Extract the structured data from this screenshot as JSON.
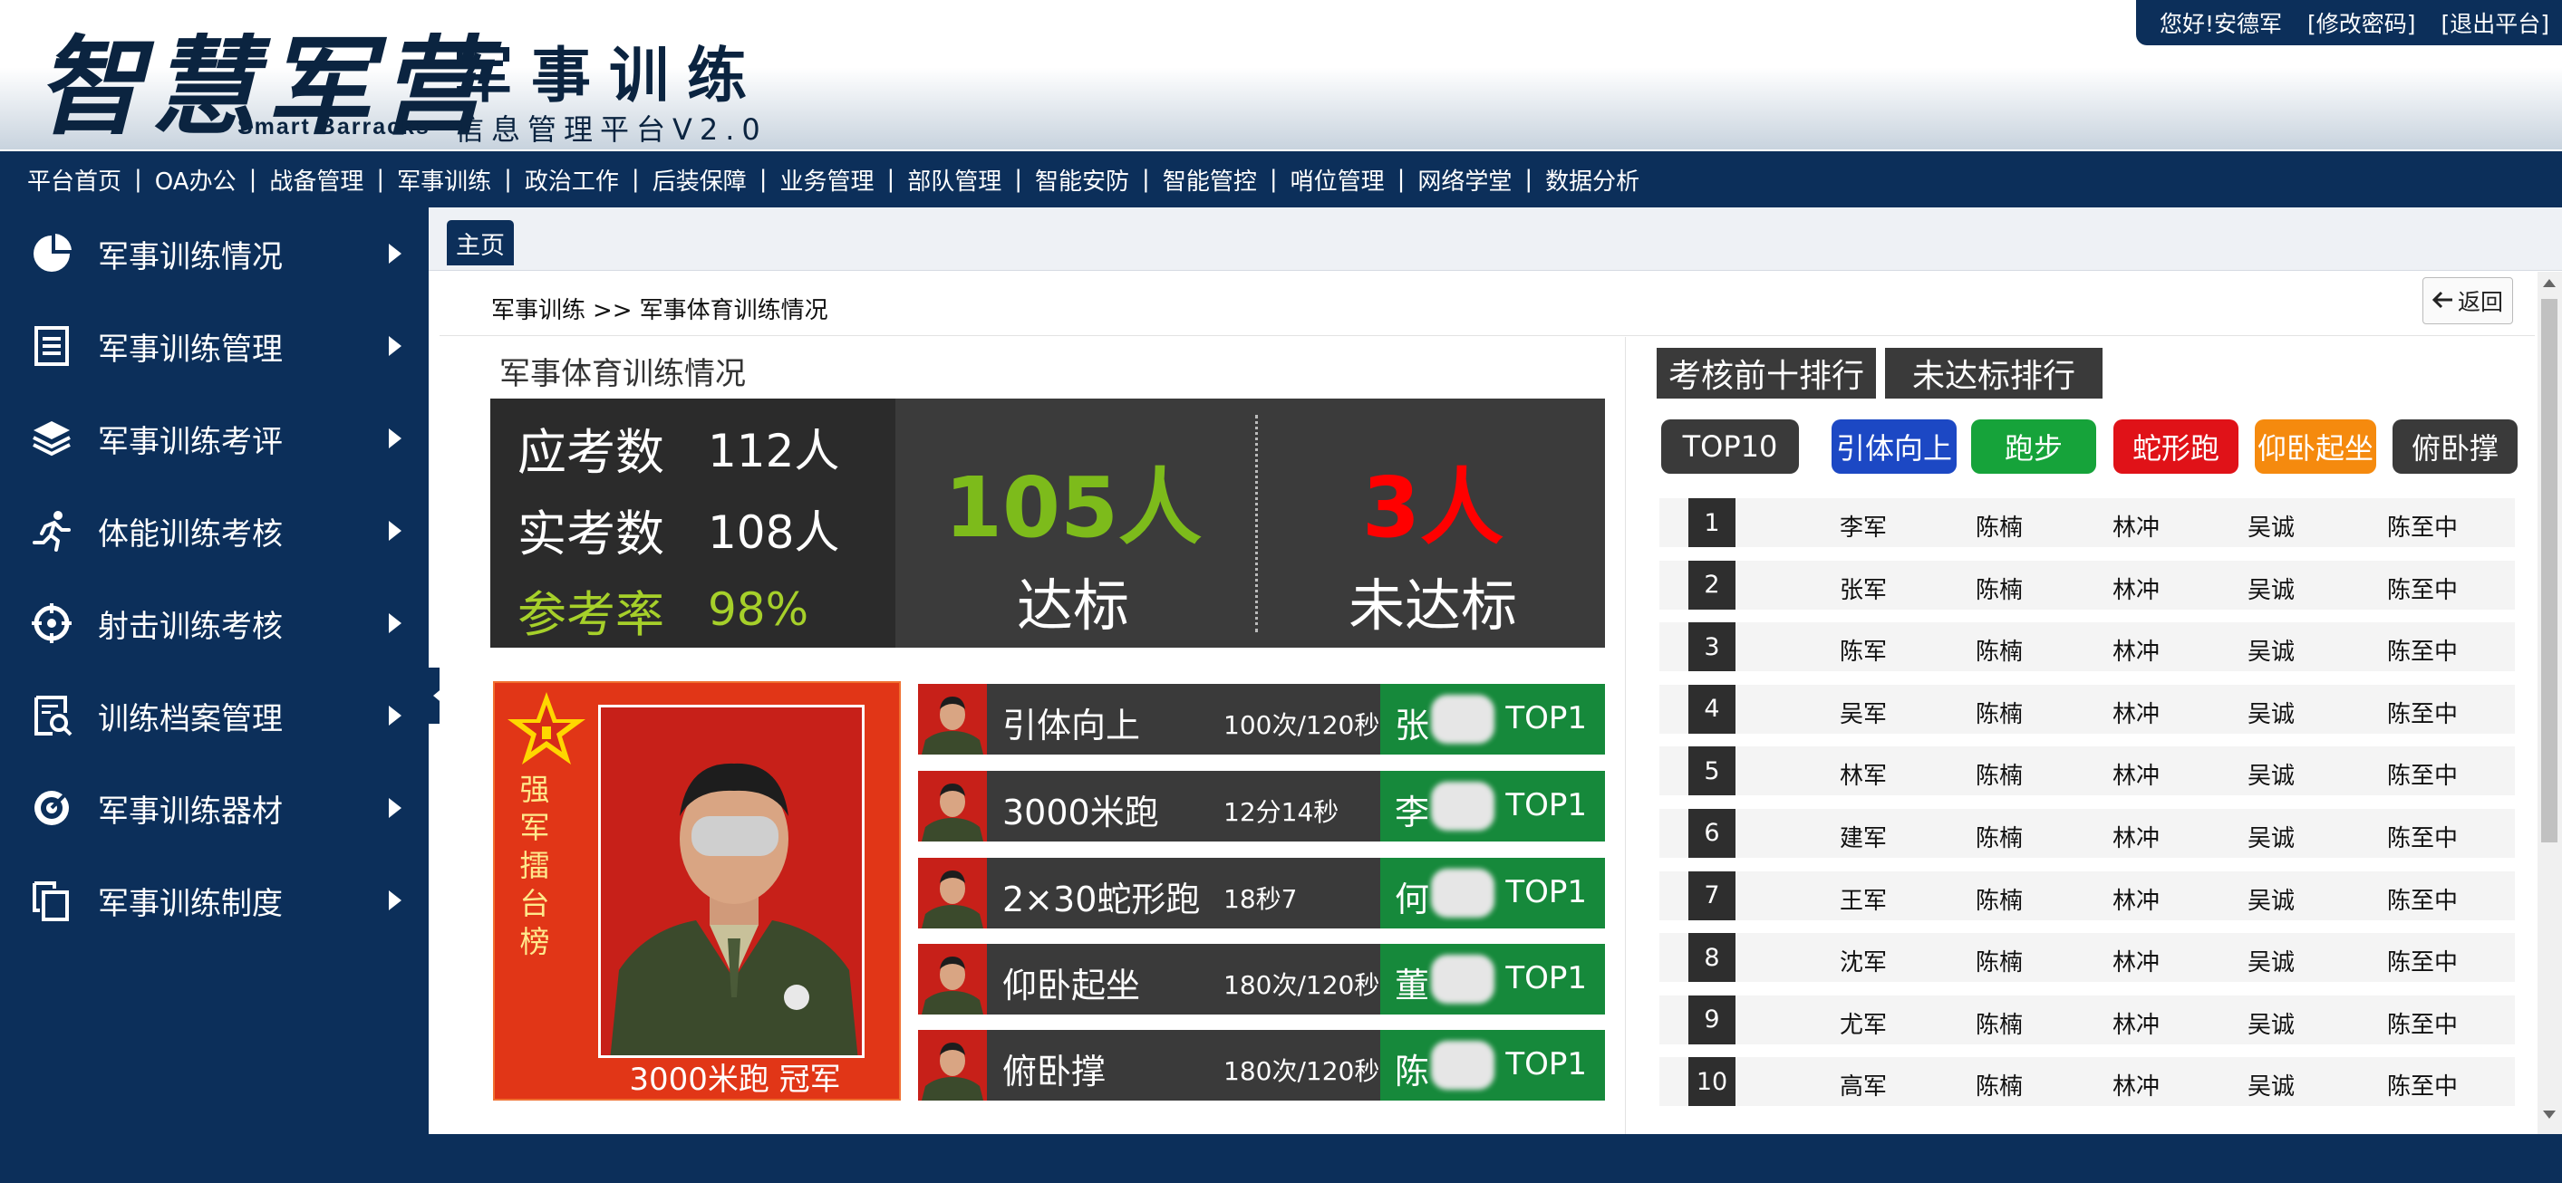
{
  "header": {
    "logo_script": "智慧军营",
    "logo_en": "Smart  Barracks",
    "title": "军事训练",
    "subtitle": "信息管理平台V2.0",
    "greeting": "您好!安德军",
    "change_password": "[修改密码]",
    "logout": "[退出平台]"
  },
  "topnav": [
    "平台首页",
    "OA办公",
    "战备管理",
    "军事训练",
    "政治工作",
    "后装保障",
    "业务管理",
    "部队管理",
    "智能安防",
    "智能管控",
    "哨位管理",
    "网络学堂",
    "数据分析"
  ],
  "sidebar": {
    "items": [
      {
        "label": "军事训练情况",
        "icon": "pie-chart-icon"
      },
      {
        "label": "军事训练管理",
        "icon": "document-list-icon"
      },
      {
        "label": "军事训练考评",
        "icon": "layers-icon"
      },
      {
        "label": "体能训练考核",
        "icon": "running-person-icon"
      },
      {
        "label": "射击训练考核",
        "icon": "crosshair-icon"
      },
      {
        "label": "训练档案管理",
        "icon": "document-search-icon"
      },
      {
        "label": "军事训练器材",
        "icon": "target-icon"
      },
      {
        "label": "军事训练制度",
        "icon": "copy-documents-icon"
      }
    ]
  },
  "tabs": {
    "home": "主页"
  },
  "breadcrumb": {
    "parent": "军事训练",
    "sep": ">>",
    "current": "军事体育训练情况"
  },
  "back_label": "返回",
  "section_title": "军事体育训练情况",
  "stats": {
    "expected_label": "应考数",
    "expected_value": "112人",
    "actual_label": "实考数",
    "actual_value": "108人",
    "rate_label": "参考率",
    "rate_value": "98%",
    "pass_count": "105人",
    "pass_label": "达标",
    "fail_count": "3人",
    "fail_label": "未达标"
  },
  "champion": {
    "vertical_text": "强军擂台榜",
    "caption": "3000米跑 冠军"
  },
  "top_events": [
    {
      "event": "引体向上",
      "score": "100次/120秒",
      "name": "张",
      "rank": "TOP1"
    },
    {
      "event": "3000米跑",
      "score": "12分14秒",
      "name": "李",
      "rank": "TOP1"
    },
    {
      "event": "2×30蛇形跑",
      "score": "18秒7",
      "name": "何",
      "rank": "TOP1"
    },
    {
      "event": "仰卧起坐",
      "score": "180次/120秒",
      "name": "董",
      "rank": "TOP1"
    },
    {
      "event": "俯卧撑",
      "score": "180次/120秒",
      "name": "陈",
      "rank": "TOP1"
    }
  ],
  "ranking": {
    "tab_top10": "考核前十排行",
    "tab_fail": "未达标排行",
    "filters": {
      "top10": "TOP10",
      "pullup": "引体向上",
      "run": "跑步",
      "snake": "蛇形跑",
      "situp": "仰卧起坐",
      "pushup": "俯卧撑"
    },
    "rows": [
      {
        "no": "1",
        "c1": "李军",
        "c2": "陈楠",
        "c3": "林冲",
        "c4": "吴诚",
        "c5": "陈至中"
      },
      {
        "no": "2",
        "c1": "张军",
        "c2": "陈楠",
        "c3": "林冲",
        "c4": "吴诚",
        "c5": "陈至中"
      },
      {
        "no": "3",
        "c1": "陈军",
        "c2": "陈楠",
        "c3": "林冲",
        "c4": "吴诚",
        "c5": "陈至中"
      },
      {
        "no": "4",
        "c1": "吴军",
        "c2": "陈楠",
        "c3": "林冲",
        "c4": "吴诚",
        "c5": "陈至中"
      },
      {
        "no": "5",
        "c1": "林军",
        "c2": "陈楠",
        "c3": "林冲",
        "c4": "吴诚",
        "c5": "陈至中"
      },
      {
        "no": "6",
        "c1": "建军",
        "c2": "陈楠",
        "c3": "林冲",
        "c4": "吴诚",
        "c5": "陈至中"
      },
      {
        "no": "7",
        "c1": "王军",
        "c2": "陈楠",
        "c3": "林冲",
        "c4": "吴诚",
        "c5": "陈至中"
      },
      {
        "no": "8",
        "c1": "沈军",
        "c2": "陈楠",
        "c3": "林冲",
        "c4": "吴诚",
        "c5": "陈至中"
      },
      {
        "no": "9",
        "c1": "尤军",
        "c2": "陈楠",
        "c3": "林冲",
        "c4": "吴诚",
        "c5": "陈至中"
      },
      {
        "no": "10",
        "c1": "高军",
        "c2": "陈楠",
        "c3": "林冲",
        "c4": "吴诚",
        "c5": "陈至中"
      }
    ]
  },
  "colors": {
    "navy": "#0c2f5a",
    "pass_green": "#7dbb1b",
    "fail_red": "#ff0000",
    "top_green": "#16893b",
    "filter_blue": "#1c48c4",
    "filter_green": "#16a33a",
    "filter_red": "#e01218",
    "filter_orange": "#f58a0e"
  }
}
